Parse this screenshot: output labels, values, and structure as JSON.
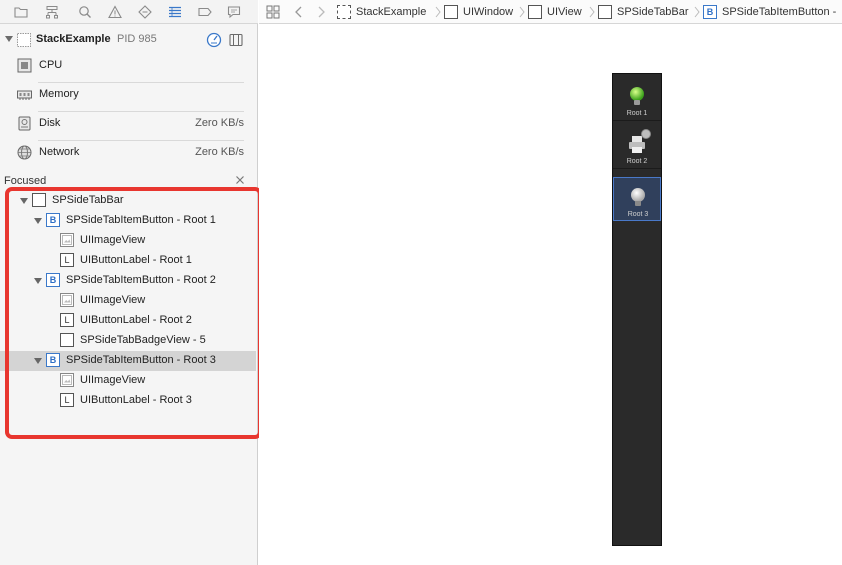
{
  "process": {
    "name": "StackExample",
    "pid": "PID 985"
  },
  "gauges": [
    {
      "label": "CPU",
      "value": ""
    },
    {
      "label": "Memory",
      "value": ""
    },
    {
      "label": "Disk",
      "value": "Zero KB/s"
    },
    {
      "label": "Network",
      "value": "Zero KB/s"
    }
  ],
  "focused": {
    "label": "Focused"
  },
  "tree": [
    {
      "label": "SPSideTabBar",
      "icon": "view",
      "letter": "",
      "depth": 0,
      "expanded": true
    },
    {
      "label": "SPSideTabItemButton - Root 1",
      "icon": "button",
      "letter": "B",
      "depth": 1,
      "expanded": true
    },
    {
      "label": "UIImageView",
      "icon": "image",
      "letter": "",
      "depth": 2
    },
    {
      "label": "UIButtonLabel - Root 1",
      "icon": "label",
      "letter": "L",
      "depth": 2
    },
    {
      "label": "SPSideTabItemButton - Root 2",
      "icon": "button",
      "letter": "B",
      "depth": 1,
      "expanded": true
    },
    {
      "label": "UIImageView",
      "icon": "image",
      "letter": "",
      "depth": 2
    },
    {
      "label": "UIButtonLabel - Root 2",
      "icon": "label",
      "letter": "L",
      "depth": 2
    },
    {
      "label": "SPSideTabBadgeView - 5",
      "icon": "view",
      "letter": "",
      "depth": 2
    },
    {
      "label": "SPSideTabItemButton - Root 3",
      "icon": "button",
      "letter": "B",
      "depth": 1,
      "expanded": true,
      "selected": true
    },
    {
      "label": "UIImageView",
      "icon": "image",
      "letter": "",
      "depth": 2
    },
    {
      "label": "UIButtonLabel - Root 3",
      "icon": "label",
      "letter": "L",
      "depth": 2
    }
  ],
  "breadcrumbs": [
    {
      "label": "StackExample",
      "letter": ""
    },
    {
      "label": "UIWindow",
      "letter": ""
    },
    {
      "label": "UIView",
      "letter": ""
    },
    {
      "label": "SPSideTabBar",
      "letter": ""
    },
    {
      "label": "SPSideTabItemButton -",
      "letter": "B"
    }
  ],
  "tabbar": {
    "items": [
      {
        "label": "Root 1",
        "icon": "lightbulb-green-icon",
        "active": false
      },
      {
        "label": "Root 2",
        "icon": "printer-icon",
        "active": false,
        "badge": ""
      },
      {
        "label": "Root 3",
        "icon": "lightbulb-white-icon",
        "active": true
      }
    ]
  },
  "colors": {
    "accent": "#3a78c9",
    "highlight": "#e8362f",
    "tabbar_bg": "#2a2a2a"
  }
}
